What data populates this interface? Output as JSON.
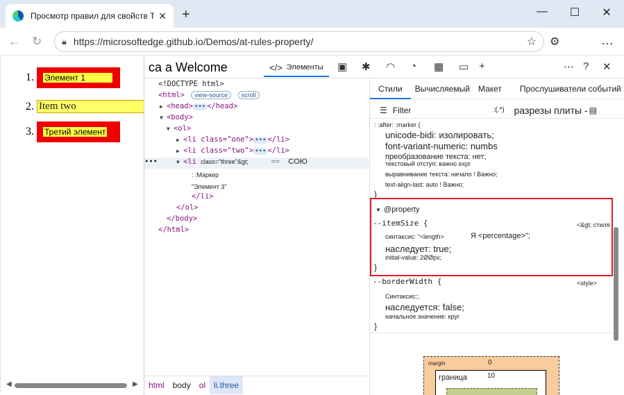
{
  "browser": {
    "tab_title": "Просмотр правил для свойств T",
    "url": "https://microsoftedge.github.io/Demos/at-rules-property/"
  },
  "page": {
    "items": [
      {
        "number": "1.",
        "text": "Элемент 1"
      },
      {
        "number": "2.",
        "text": "Item two"
      },
      {
        "number": "3.",
        "text": "Третий элемент"
      }
    ]
  },
  "devtools": {
    "welcome_text": "са а Welcome",
    "elements_tab": "Элементы",
    "dom": {
      "doctype": "<!DOCTYPE html>",
      "html_open": "<html>",
      "view_source": "view-source",
      "scroll": "scroll",
      "head": "<head>",
      "head_close": "</head>",
      "ellipsis": "•••",
      "body_open": "<body>",
      "ol_open": "<ol>",
      "li_one": "<li class=\"one\">",
      "li_two": "<li class=\"two\">",
      "li_close": "</li>",
      "li_three": "<li",
      "li_three_attr": "class=\"three\"&gt;",
      "eq_marker": "==",
      "co_text": "COЮ",
      "marker_note": ": :Маркер",
      "element3_note": "\"Элемент 3\"",
      "li_close_indent": "</li>",
      "ol_close": "</ol>",
      "body_close": "</body>",
      "html_close": "</html>",
      "row_dots": "•••"
    },
    "breadcrumbs": [
      "html",
      "body",
      "ol",
      "li.three"
    ],
    "styles_tabs": [
      "Стили",
      "Вычисляемый",
      "Макет",
      "Прослушиватели событий"
    ],
    "filter": {
      "label": "Filter",
      "pseudo": ":(.*)",
      "right_text": "разрезы плиты -"
    },
    "rules": {
      "after_marker": ": :after: :marker {",
      "unicode_bidi": "unicode-bidi: изолировать;",
      "font_variant": "font-variant-numeric: numbs",
      "text_transform": "преобразование текста: нет;",
      "text_indent": "текстовый отступ: важно expr",
      "text_align": "выравнивание текста: начало ! Важно;",
      "text_align_last": "text-align-last: auto ! Важно;",
      "brace_close": "}",
      "property_header": "@property",
      "item_size": "--itemSize {",
      "item_size_source": "<&gt; стиля",
      "syntax1_label": "синтаксис: \"<length>",
      "syntax1_value": "Я <percentage>\";",
      "inherits1": "наследует: true;",
      "initial1": "initial-value: 2ØØpx;",
      "brace_close2": "}",
      "border_width": "--borderWidth {",
      "border_width_source": "<style>",
      "syntax2": "Синтаксис:;",
      "inherits2": "наследуется: false;",
      "initial2": "начальное значение: круг",
      "brace_close3": "}"
    },
    "box_model": {
      "margin_label": "margin",
      "margin_value": "0",
      "border_label": "граница",
      "border_value": "10"
    }
  }
}
